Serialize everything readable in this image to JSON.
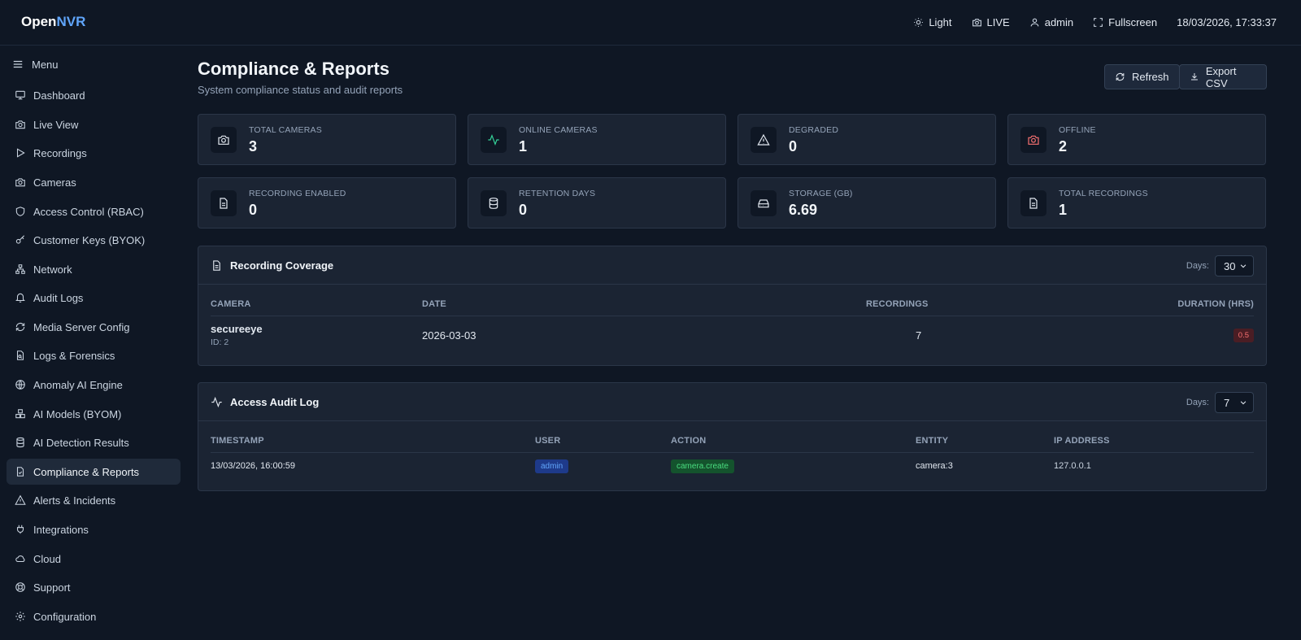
{
  "app": {
    "logo_primary": "Open",
    "logo_accent": "NVR"
  },
  "topbar": {
    "theme_label": "Light",
    "live_label": "LIVE",
    "user_label": "admin",
    "fullscreen_label": "Fullscreen",
    "clock": "18/03/2026, 17:33:37"
  },
  "sidebar": {
    "menu_label": "Menu",
    "items": [
      {
        "label": "Dashboard",
        "icon": "monitor-icon"
      },
      {
        "label": "Live View",
        "icon": "camera-icon"
      },
      {
        "label": "Recordings",
        "icon": "play-icon"
      },
      {
        "label": "Cameras",
        "icon": "camera-icon"
      },
      {
        "label": "Access Control (RBAC)",
        "icon": "shield-icon"
      },
      {
        "label": "Customer Keys (BYOK)",
        "icon": "key-icon"
      },
      {
        "label": "Network",
        "icon": "network-icon"
      },
      {
        "label": "Audit Logs",
        "icon": "bell-icon"
      },
      {
        "label": "Media Server Config",
        "icon": "refresh-icon"
      },
      {
        "label": "Logs & Forensics",
        "icon": "file-search-icon"
      },
      {
        "label": "Anomaly AI Engine",
        "icon": "globe-icon"
      },
      {
        "label": "AI Models (BYOM)",
        "icon": "boxes-icon"
      },
      {
        "label": "AI Detection Results",
        "icon": "database-icon"
      },
      {
        "label": "Compliance & Reports",
        "icon": "file-check-icon",
        "active": true
      },
      {
        "label": "Alerts & Incidents",
        "icon": "alert-icon"
      },
      {
        "label": "Integrations",
        "icon": "plug-icon"
      },
      {
        "label": "Cloud",
        "icon": "cloud-icon"
      },
      {
        "label": "Support",
        "icon": "lifebuoy-icon"
      },
      {
        "label": "Configuration",
        "icon": "gear-icon"
      }
    ]
  },
  "page": {
    "title": "Compliance & Reports",
    "subtitle": "System compliance status and audit reports",
    "refresh_label": "Refresh",
    "export_label": "Export CSV"
  },
  "stats": [
    {
      "label": "TOTAL CAMERAS",
      "value": "3",
      "icon": "camera-icon",
      "color": "#e2e8f0"
    },
    {
      "label": "ONLINE CAMERAS",
      "value": "1",
      "icon": "activity-icon",
      "color": "#34d399"
    },
    {
      "label": "DEGRADED",
      "value": "0",
      "icon": "alert-icon",
      "color": "#e2e8f0"
    },
    {
      "label": "OFFLINE",
      "value": "2",
      "icon": "camera-icon",
      "color": "#f87171"
    },
    {
      "label": "RECORDING ENABLED",
      "value": "0",
      "icon": "file-icon",
      "color": "#e2e8f0"
    },
    {
      "label": "RETENTION DAYS",
      "value": "0",
      "icon": "database-icon",
      "color": "#e2e8f0"
    },
    {
      "label": "STORAGE (GB)",
      "value": "6.69",
      "icon": "hard-drive-icon",
      "color": "#e2e8f0"
    },
    {
      "label": "TOTAL RECORDINGS",
      "value": "1",
      "icon": "file-icon",
      "color": "#e2e8f0"
    }
  ],
  "coverage": {
    "title": "Recording Coverage",
    "days_label": "Days:",
    "days_value": "30",
    "columns": [
      "CAMERA",
      "DATE",
      "RECORDINGS",
      "DURATION (HRS)"
    ],
    "rows": [
      {
        "camera": "secureeye",
        "camera_id": "ID: 2",
        "date": "2026-03-03",
        "recordings": "7",
        "duration": "0.5"
      }
    ]
  },
  "audit": {
    "title": "Access Audit Log",
    "days_label": "Days:",
    "days_value": "7",
    "columns": [
      "TIMESTAMP",
      "USER",
      "ACTION",
      "ENTITY",
      "IP ADDRESS"
    ],
    "rows": [
      {
        "timestamp": "13/03/2026, 16:00:59",
        "user": "admin",
        "action": "camera.create",
        "entity": "camera:3",
        "ip": "127.0.0.1"
      }
    ]
  }
}
